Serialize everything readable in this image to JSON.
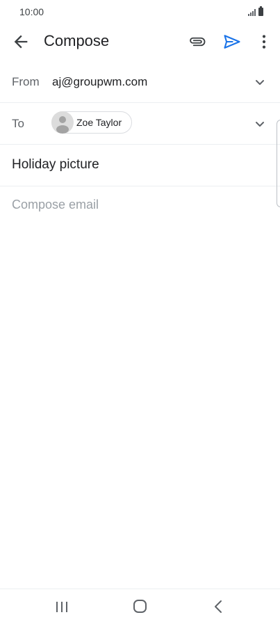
{
  "status_bar": {
    "time": "10:00"
  },
  "app_bar": {
    "title": "Compose",
    "icons": {
      "back": "arrow-back-icon",
      "attach": "paperclip-icon",
      "send": "send-icon",
      "more": "more-vert-icon"
    }
  },
  "from_row": {
    "label": "From",
    "value": "aj@groupwm.com"
  },
  "to_row": {
    "label": "To",
    "recipient": "Zoe Taylor"
  },
  "subject": "Holiday picture",
  "body": {
    "placeholder": "Compose email"
  },
  "colors": {
    "accent": "#1a73e8",
    "placeholder": "#9aa0a6",
    "divider": "#eceff1"
  }
}
